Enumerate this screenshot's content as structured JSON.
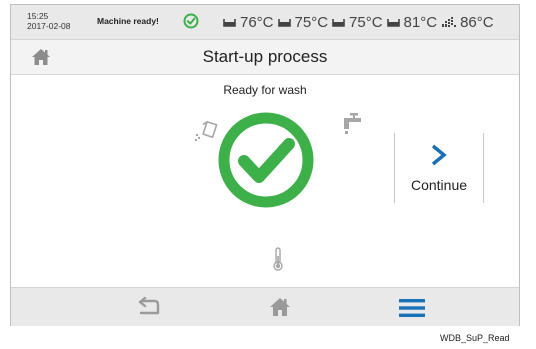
{
  "status_bar": {
    "time": "15:25",
    "date": "2017-02-08",
    "machine_status": "Machine ready!",
    "temperatures": [
      {
        "icon": "tank-icon",
        "value": "76°C"
      },
      {
        "icon": "tank-icon",
        "value": "75°C"
      },
      {
        "icon": "tank-icon",
        "value": "75°C"
      },
      {
        "icon": "tank-icon",
        "value": "81°C"
      },
      {
        "icon": "rinse-icon",
        "value": "86°C"
      }
    ]
  },
  "header": {
    "title": "Start-up process"
  },
  "main": {
    "status_text": "Ready for wash",
    "continue_label": "Continue"
  },
  "caption": "WDB_SuP_Read",
  "colors": {
    "ready_green": "#3db04a",
    "accent_blue": "#1a70b8",
    "icon_gray": "#a6a6a6"
  }
}
